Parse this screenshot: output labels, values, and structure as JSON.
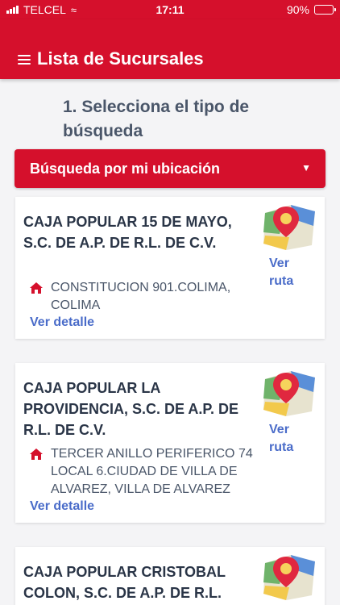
{
  "status_bar": {
    "carrier": "TELCEL",
    "time": "17:11",
    "battery_text": "90%",
    "battery_level": 0.9
  },
  "header": {
    "title": "Lista de Sucursales",
    "menu_icon": "hamburger-icon"
  },
  "section": {
    "title": "1. Selecciona el tipo de búsqueda"
  },
  "search_type": {
    "selected": "Búsqueda por mi ubicación",
    "icon": "chevron-down-icon"
  },
  "branches": [
    {
      "name": "CAJA POPULAR 15 DE MAYO, S.C. DE A.P. DE R.L. DE C.V.",
      "address": "CONSTITUCION 901.COLIMA, COLIMA",
      "detail_label": "Ver detalle",
      "route_label": "Ver ruta"
    },
    {
      "name": "CAJA POPULAR LA PROVIDENCIA, S.C. DE A.P. DE R.L. DE C.V.",
      "address": "TERCER ANILLO PERIFERICO 74 LOCAL 6.CIUDAD DE VILLA DE ALVAREZ, VILLA DE ALVAREZ",
      "detail_label": "Ver detalle",
      "route_label": "Ver ruta"
    },
    {
      "name": "CAJA POPULAR CRISTOBAL COLON, S.C. DE A.P. DE R.L.",
      "address": "",
      "detail_label": "",
      "route_label": ""
    }
  ],
  "colors": {
    "brand_red": "#d5102c",
    "link_blue": "#4a6cc9",
    "background": "#f4f4f6"
  }
}
